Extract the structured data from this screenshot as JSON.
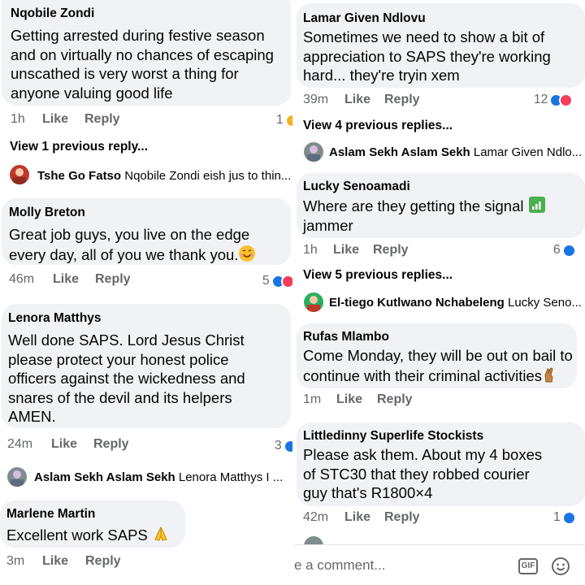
{
  "left": {
    "c1": {
      "name": "Nqobile Zondi",
      "text": "Getting arrested during festive season and on virtually no chances of escaping unscathed is very worst a thing for anyone valuing good life",
      "time": "1h",
      "like": "Like",
      "reply": "Reply",
      "count": "1"
    },
    "vp1": "View 1 previous reply...",
    "r1": {
      "author": "Tshe Go Fatso",
      "preview": "Nqobile Zondi eish jus to thin..."
    },
    "c2": {
      "name": "Molly Breton",
      "text": "Great job guys, you live on the edge every day, all of you we thank you.",
      "time": "46m",
      "like": "Like",
      "reply": "Reply",
      "count": "5"
    },
    "c3": {
      "name": "Lenora Matthys",
      "text": "Well done SAPS. Lord Jesus Christ please protect your honest police officers against the wickedness and snares of the devil and its helpers AMEN.",
      "time": "24m",
      "like": "Like",
      "reply": "Reply",
      "count": "3"
    },
    "r2": {
      "author": "Aslam Sekh Aslam Sekh",
      "preview": "Lenora Matthys I ..."
    },
    "c4": {
      "name": "Marlene Martin",
      "text": "Excellent work SAPS",
      "time": "3m",
      "like": "Like",
      "reply": "Reply"
    }
  },
  "right": {
    "c1": {
      "name": "Lamar Given Ndlovu",
      "text": "Sometimes we need to show a bit of appreciation to SAPS  they're working hard... they're tryin xem",
      "time": "39m",
      "like": "Like",
      "reply": "Reply",
      "count": "12"
    },
    "vp1": "View 4 previous replies...",
    "r1": {
      "author": "Aslam Sekh Aslam Sekh",
      "preview": "Lamar Given Ndlo..."
    },
    "c2": {
      "name": "Lucky Senoamadi",
      "text": "Where are they getting the signal",
      "text2": "jammer",
      "time": "1h",
      "like": "Like",
      "reply": "Reply",
      "count": "6"
    },
    "vp2": "View 5 previous replies...",
    "r2": {
      "author": "El-tiego Kutlwano Nchabeleng",
      "preview": "Lucky Seno..."
    },
    "c3": {
      "name": "Rufas Mlambo",
      "text": "Come Monday, they will be out on bail to continue with their criminal activities",
      "time": "1m",
      "like": "Like",
      "reply": "Reply"
    },
    "c4": {
      "name": "Littledinny Superlife Stockists",
      "text": "Please ask them. About my 4 boxes of STC30 that they robbed courier guy that's R1800×4",
      "time": "42m",
      "like": "Like",
      "reply": "Reply",
      "count": "1"
    },
    "composer": {
      "placeholder": "e a comment...",
      "gif": "GIF"
    }
  },
  "colors": {
    "bubble": "#f0f2f5",
    "meta": "#65676b",
    "like": "#1b74e4",
    "love": "#f33e58"
  }
}
